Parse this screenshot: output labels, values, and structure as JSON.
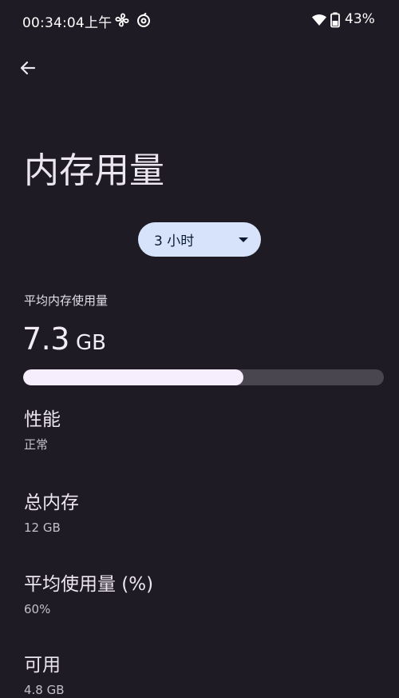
{
  "status_bar": {
    "time": "00:34:04上午",
    "battery": "43%",
    "icons": [
      "fan-icon",
      "sync-circle-icon",
      "wifi-icon",
      "battery-icon"
    ]
  },
  "header": {
    "back_icon": "arrow-left-icon",
    "title": "内存用量"
  },
  "period_selector": {
    "value": "3 小时",
    "icon": "caret-down-icon"
  },
  "average": {
    "label": "平均内存使用量",
    "value": "7.3",
    "unit": "GB",
    "usage_fraction": 0.61
  },
  "details": [
    {
      "title": "性能",
      "value": "正常"
    },
    {
      "title": "总内存",
      "value": "12 GB"
    },
    {
      "title": "平均使用量 (%)",
      "value": "60%"
    },
    {
      "title": "可用",
      "value": "4.8 GB"
    }
  ],
  "colors": {
    "background": "#1e1b24",
    "chip": "#d6e3fb",
    "progress_fill": "#f6edfd",
    "progress_track": "#4a4650"
  }
}
